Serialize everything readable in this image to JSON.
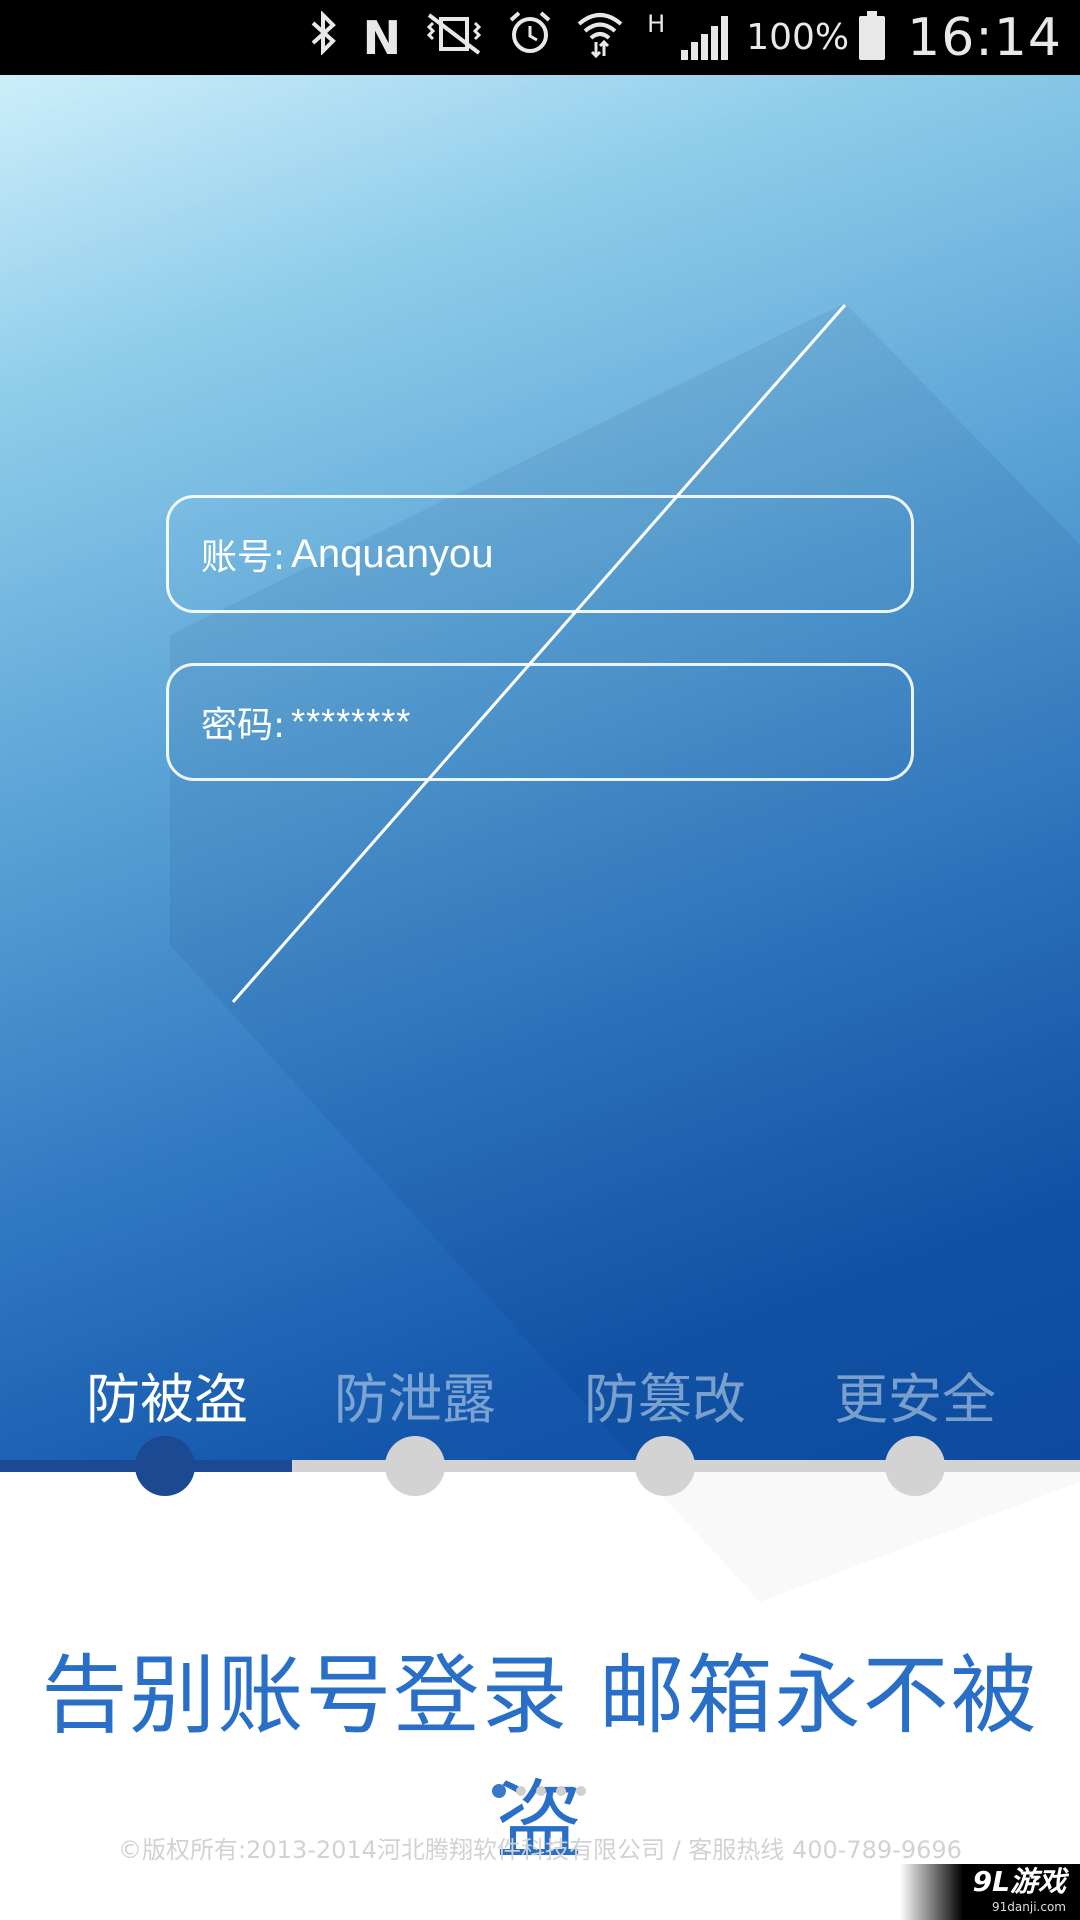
{
  "status_bar": {
    "icons": [
      "bluetooth-icon",
      "nfc-icon",
      "vibrate-mute-icon",
      "alarm-icon",
      "wifi-icon",
      "network-h-icon",
      "signal-icon",
      "battery-icon"
    ],
    "nfc_glyph": "N",
    "network_type": "H",
    "battery": "100%",
    "time": "16:14"
  },
  "login_mock": {
    "account_label": "账号:",
    "account_value": "Anquanyou",
    "password_label": "密码:",
    "password_value": "********"
  },
  "steps": {
    "items": [
      "防被盗",
      "防泄露",
      "防篡改",
      "更安全"
    ],
    "active_index": 0
  },
  "headline": "告别账号登录 邮箱永不被盗",
  "pager": {
    "count": 5,
    "active_index": 0
  },
  "copyright": "©版权所有:2013-2014河北腾翔软件科技有限公司 / 客服热线 400-789-9696",
  "watermark": {
    "main": "9L游戏",
    "sub": "91danji.com"
  },
  "colors": {
    "accent_dark": "#1c4a92",
    "headline_blue": "#2a6fc7",
    "inactive_gray": "#d3d3d3"
  }
}
